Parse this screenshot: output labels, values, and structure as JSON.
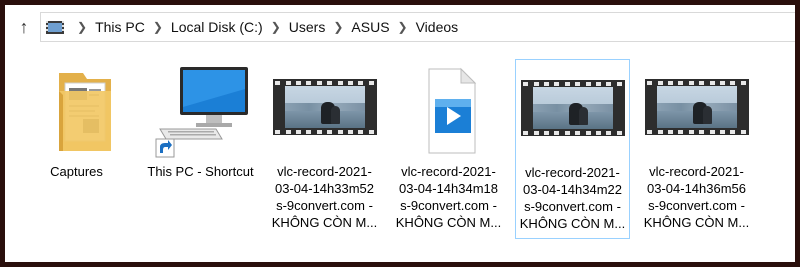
{
  "addressbar": {
    "breadcrumbs": [
      "This PC",
      "Local Disk (C:)",
      "Users",
      "ASUS",
      "Videos"
    ]
  },
  "items": [
    {
      "label_lines": [
        "Captures"
      ],
      "icon": "folder-icon"
    },
    {
      "label_lines": [
        "This PC - Shortcut"
      ],
      "icon": "computer-shortcut-icon"
    },
    {
      "label_lines": [
        "vlc-record-2021-",
        "03-04-14h33m52",
        "s-9convert.com -",
        "KHÔNG CÒN M..."
      ],
      "icon": "video-thumbnail"
    },
    {
      "label_lines": [
        "vlc-record-2021-",
        "03-04-14h34m18",
        "s-9convert.com -",
        "KHÔNG CÒN M..."
      ],
      "icon": "video-file-icon"
    },
    {
      "label_lines": [
        "vlc-record-2021-",
        "03-04-14h34m22",
        "s-9convert.com -",
        "KHÔNG CÒN M..."
      ],
      "icon": "video-thumbnail",
      "selected": true
    },
    {
      "label_lines": [
        "vlc-record-2021-",
        "03-04-14h36m56",
        "s-9convert.com -",
        "KHÔNG CÒN M..."
      ],
      "icon": "video-thumbnail"
    }
  ],
  "colors": {
    "frame_border": "#2a0f0c",
    "selection_border": "#99d1ff",
    "accent_blue": "#1b7fd6"
  }
}
